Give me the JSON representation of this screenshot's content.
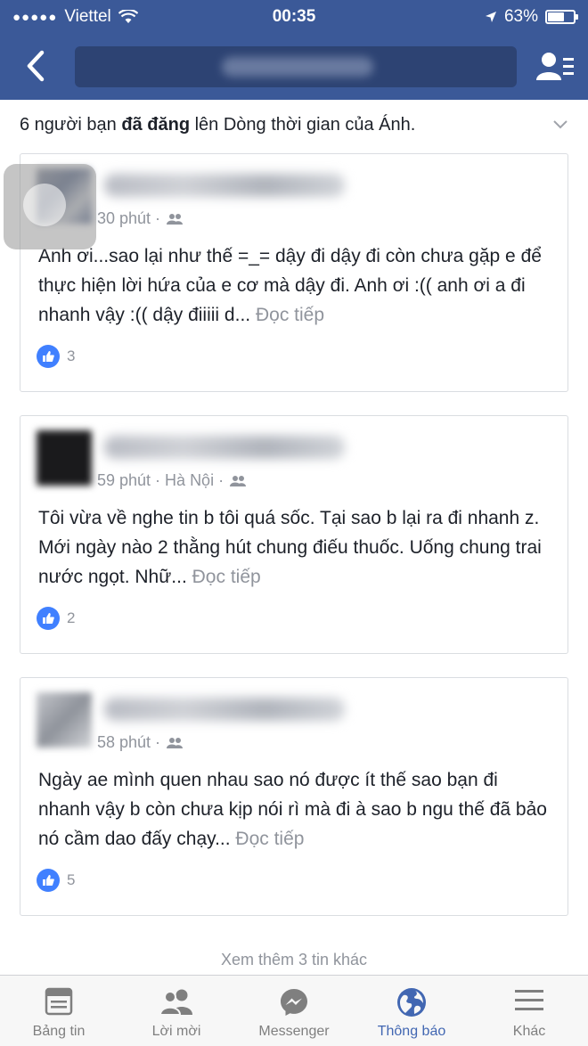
{
  "status_bar": {
    "carrier": "Viettel",
    "time": "00:35",
    "battery": "63%",
    "battery_level": 0.63
  },
  "nav": {
    "back_icon": "chevron-left-icon",
    "search_value": "",
    "friend_requests_icon": "friend-requests-icon"
  },
  "notification": {
    "prefix": "6 người bạn ",
    "bold": "đã đăng",
    "suffix": " lên Dòng thời gian của Ánh."
  },
  "posts": [
    {
      "meta": "30 phút ·",
      "text": "Anh ơi...sao lại như thế =_= dậy đi dậy đi còn chưa gặp e để thực hiện lời hứa của e cơ mà dậy đi. Anh ơi :(( anh ơi a đi nhanh vậy :(( dậy điiiii d...",
      "more": "Đọc tiếp",
      "likes": "3"
    },
    {
      "meta": "59 phút · Hà Nội ·",
      "text": "Tôi vừa về nghe tin b tôi quá sốc. Tại sao b lại ra đi nhanh z. Mới ngày nào 2 thằng hút chung điếu thuốc. Uống chung trai nước ngọt. Nhữ...",
      "more": "Đọc tiếp",
      "likes": "2"
    },
    {
      "meta": "58 phút ·",
      "text": "Ngày ae mình quen nhau sao nó được ít thế sao bạn đi nhanh vậy b còn chưa kịp nói rì mà đi à sao b ngu thế đã bảo nó cầm dao đấy chạy...",
      "more": "Đọc tiếp",
      "likes": "5"
    }
  ],
  "see_more": "Xem thêm 3 tin khác",
  "tabs": [
    {
      "label": "Bảng tin",
      "icon": "news-feed-icon"
    },
    {
      "label": "Lời mời",
      "icon": "friend-requests-icon"
    },
    {
      "label": "Messenger",
      "icon": "messenger-icon"
    },
    {
      "label": "Thông báo",
      "icon": "notifications-globe-icon",
      "active": true
    },
    {
      "label": "Khác",
      "icon": "menu-icon"
    }
  ],
  "colors": {
    "brand": "#3b5998",
    "active_tab": "#4267b2",
    "like": "#4080ff",
    "muted": "#90949c"
  }
}
